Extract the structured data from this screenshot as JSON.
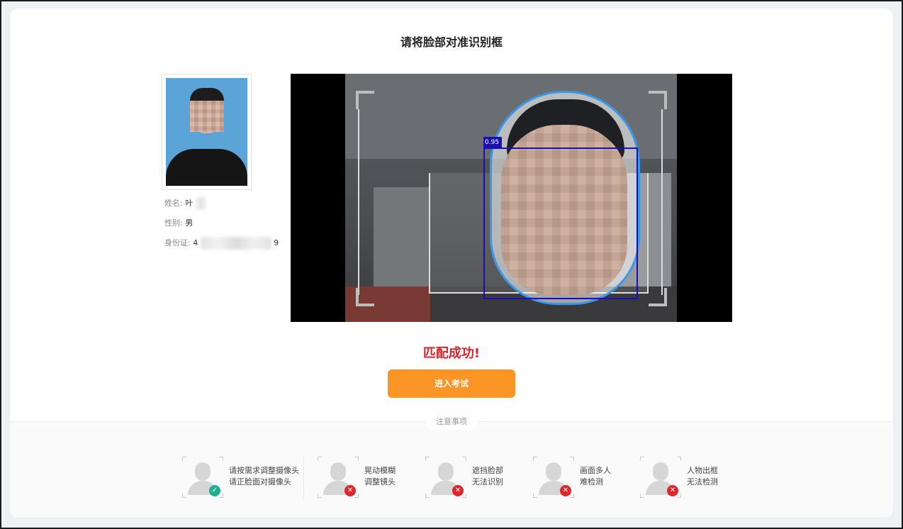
{
  "title": "请将脸部对准识别框",
  "profile": {
    "name_label": "姓名:",
    "name_value": "叶",
    "gender_label": "性别:",
    "gender_value": "男",
    "id_label": "身份证:",
    "id_prefix": "4",
    "id_suffix": "9"
  },
  "camera": {
    "detect_tag": "0.95"
  },
  "result": {
    "text": "匹配成功!",
    "color": "#d9262b"
  },
  "enter_button": {
    "label": "进入考试",
    "color": "#fb9526"
  },
  "notes": {
    "title": "注意事项",
    "tips": [
      {
        "line1": "请按需求调整摄像头",
        "line2": "请正脸面对摄像头",
        "status": "ok",
        "badge_color": "#1db18c",
        "icon": "check-icon"
      },
      {
        "line1": "晃动模糊",
        "line2": "调整镜头",
        "status": "error",
        "badge_color": "#e0262b",
        "icon": "cross-icon"
      },
      {
        "line1": "遮挡脸部",
        "line2": "无法识别",
        "status": "error",
        "badge_color": "#e0262b",
        "icon": "cross-icon"
      },
      {
        "line1": "画面多人",
        "line2": "难检测",
        "status": "error",
        "badge_color": "#e0262b",
        "icon": "cross-icon"
      },
      {
        "line1": "人物出框",
        "line2": "无法检测",
        "status": "error",
        "badge_color": "#e0262b",
        "icon": "cross-icon"
      }
    ]
  }
}
